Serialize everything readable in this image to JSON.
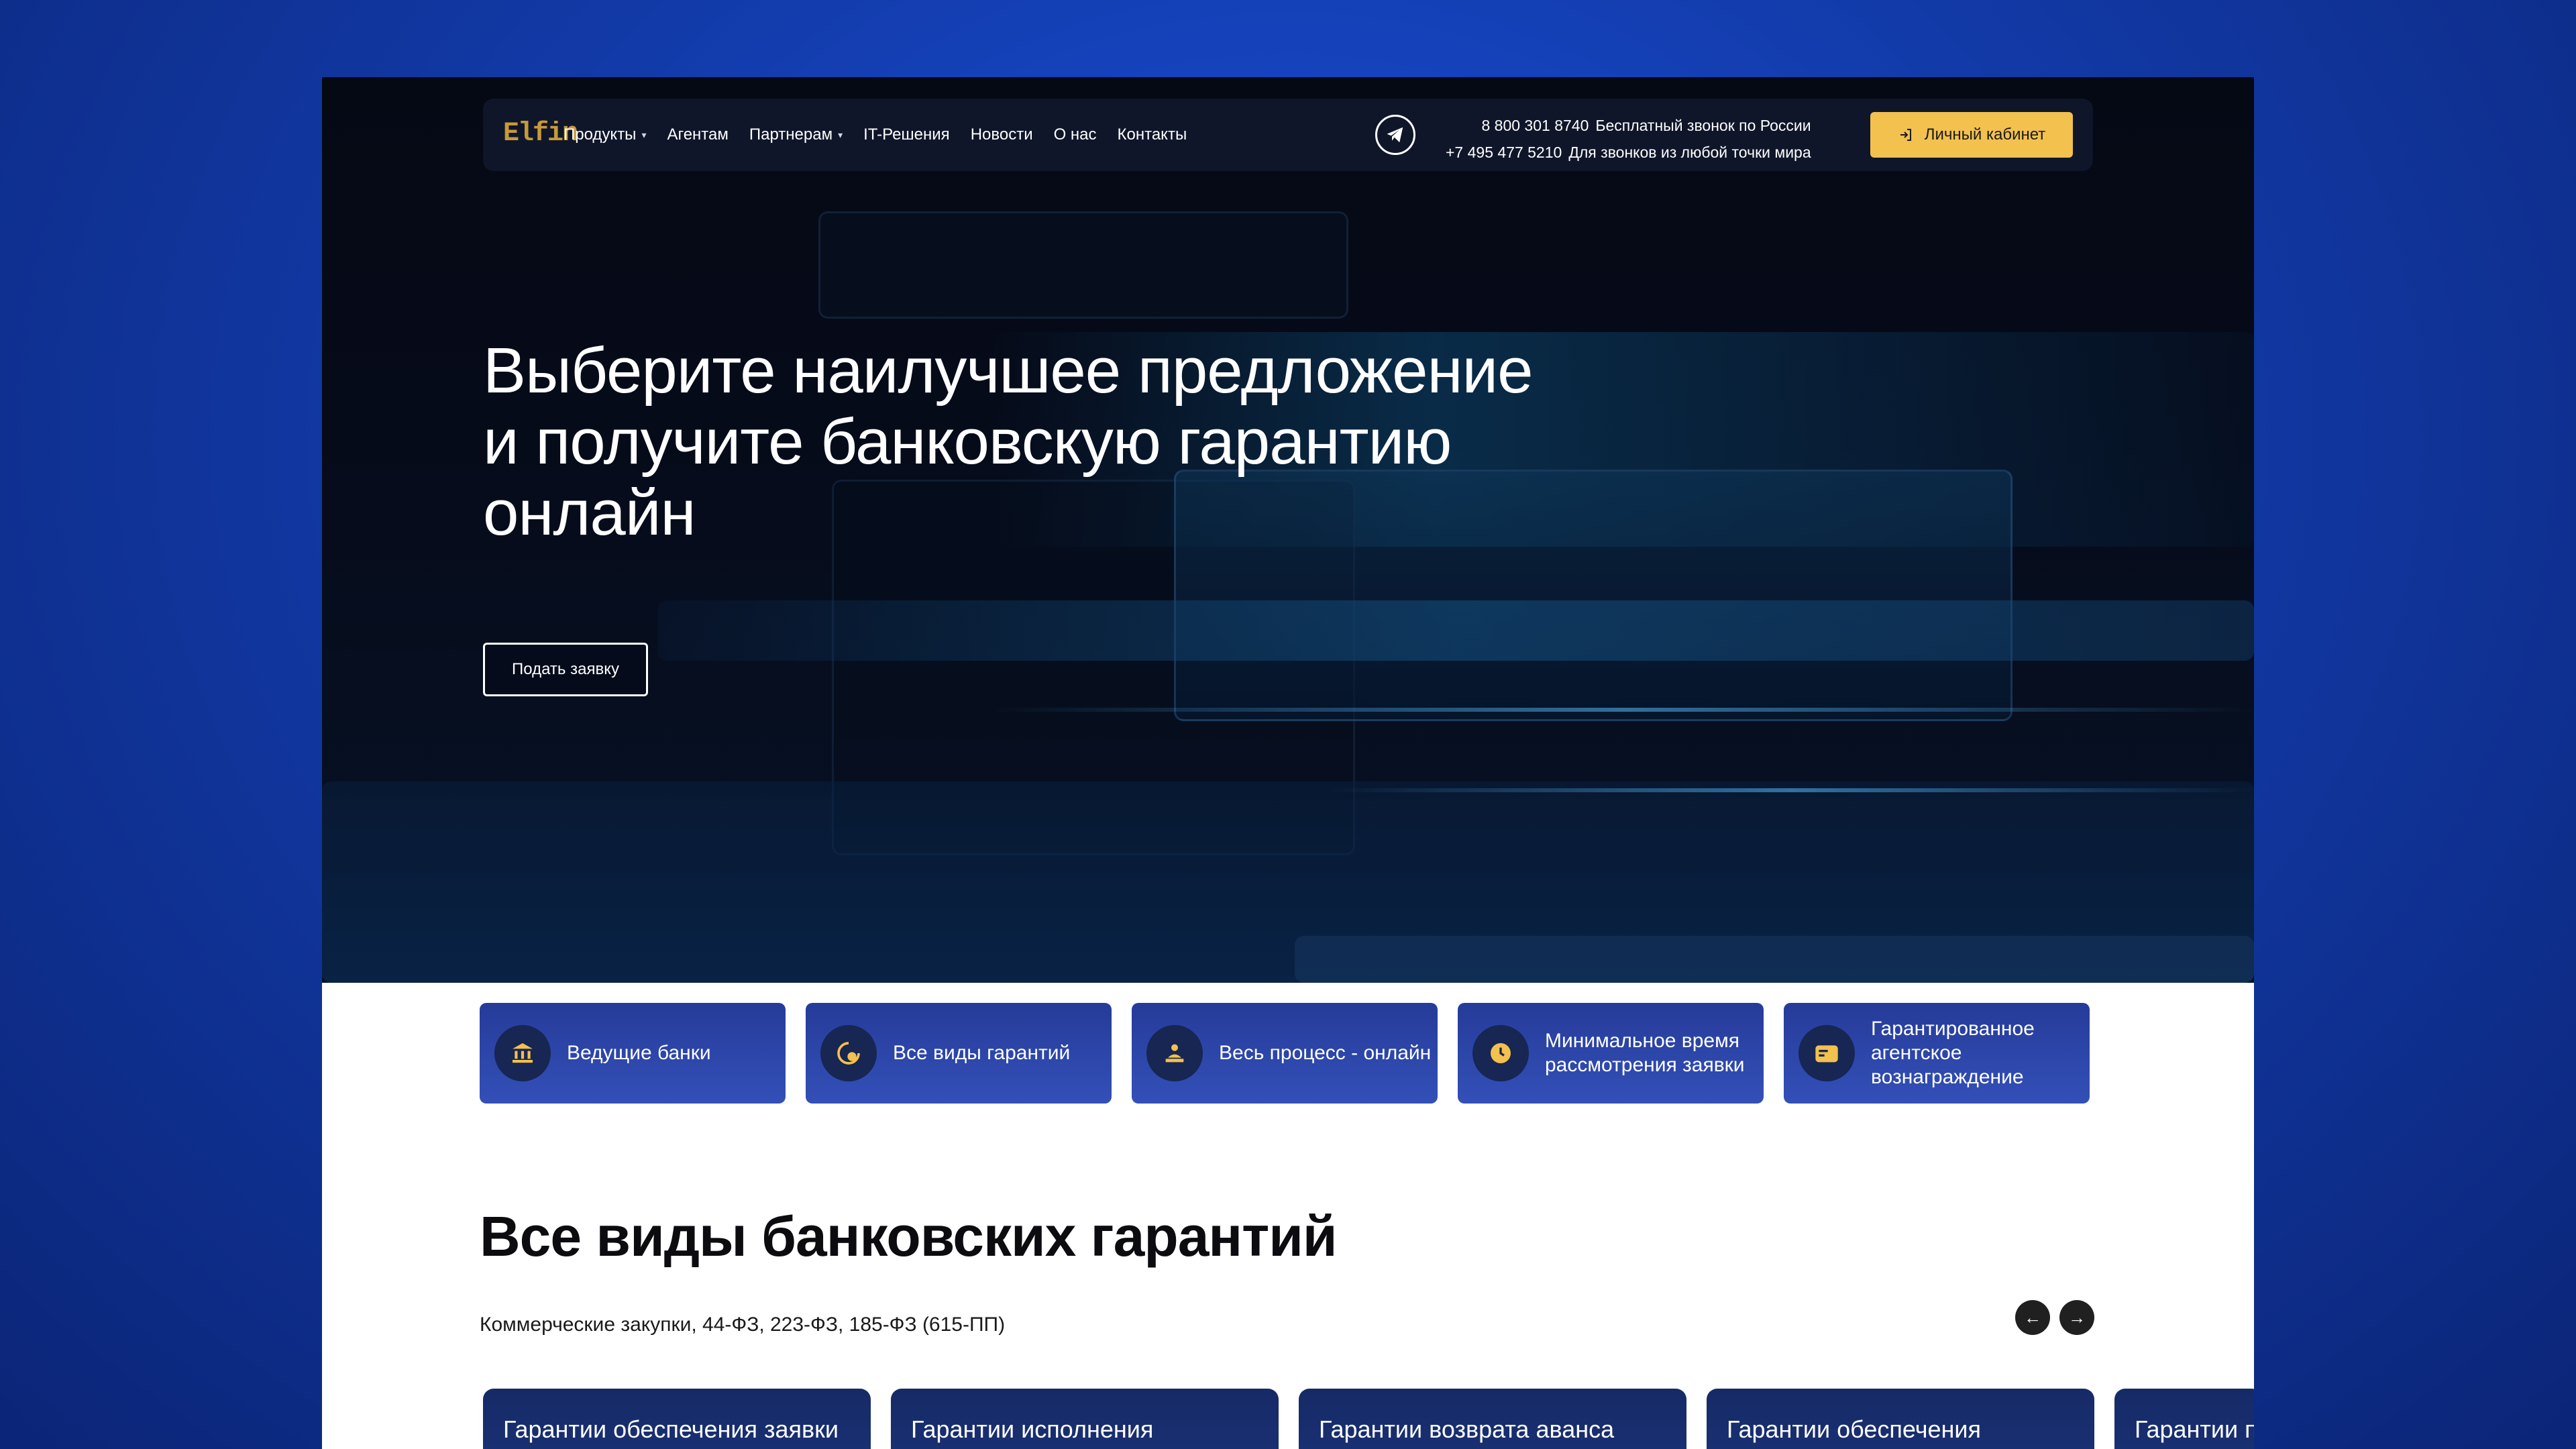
{
  "brand": {
    "logo": "Elfin",
    "accent": "#f2c14e",
    "primary": "#263b99"
  },
  "nav": {
    "items": [
      {
        "label": "Продукты",
        "has_dropdown": true
      },
      {
        "label": "Агентам",
        "has_dropdown": false
      },
      {
        "label": "Партнерам",
        "has_dropdown": true
      },
      {
        "label": "IT-Решения",
        "has_dropdown": false
      },
      {
        "label": "Новости",
        "has_dropdown": false
      },
      {
        "label": "О нас",
        "has_dropdown": false
      },
      {
        "label": "Контакты",
        "has_dropdown": false
      }
    ],
    "telegram_icon": "telegram-icon",
    "phones": [
      {
        "number": "8 800 301 8740",
        "note": "Бесплатный звонок по России"
      },
      {
        "number": "+7 495 477 5210",
        "note": "Для звонков из любой точки мира"
      }
    ],
    "cabinet_label": "Личный кабинет"
  },
  "hero": {
    "title_lines": [
      "Выберите наилучшее предложение",
      "и получите банковскую гарантию",
      "онлайн"
    ],
    "cta_label": "Подать заявку"
  },
  "features": [
    {
      "icon": "bank-icon",
      "label": "Ведущие банки"
    },
    {
      "icon": "guarantee-icon",
      "label": "Все виды гарантий"
    },
    {
      "icon": "online-process-icon",
      "label": "Весь процесс - онлайн"
    },
    {
      "icon": "clock-icon",
      "label": "Минимальное время рассмотрения заявки"
    },
    {
      "icon": "wallet-icon",
      "label": "Гарантированное агентское вознаграждение"
    }
  ],
  "guarantees_section": {
    "title": "Все виды банковских гарантий",
    "subtitle": "Коммерческие закупки, 44-ФЗ, 223-ФЗ, 185-ФЗ (615-ПП)",
    "cards": [
      "Гарантии обеспечения заявки",
      "Гарантии исполнения",
      "Гарантии возврата аванса",
      "Гарантии обеспечения",
      "Гарантии п"
    ]
  }
}
